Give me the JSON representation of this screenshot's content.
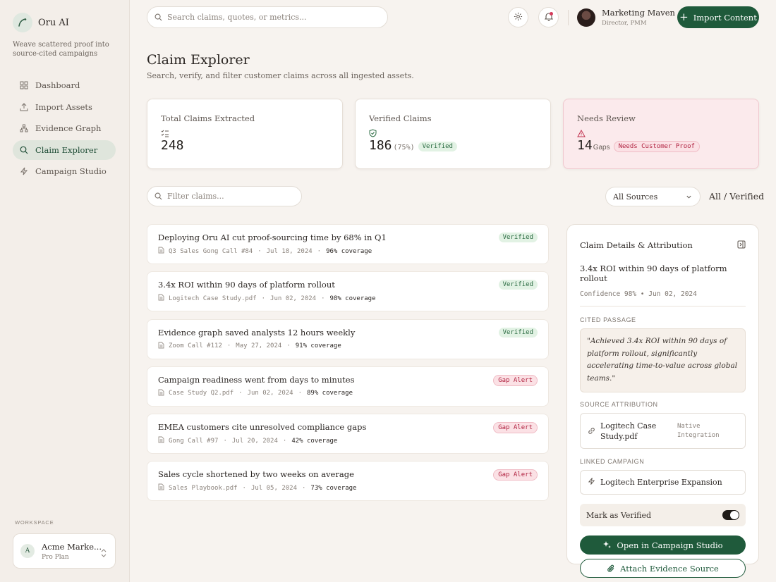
{
  "app": {
    "name": "Oru AI",
    "tagline": "Weave scattered proof into source-cited campaigns"
  },
  "sidebar": {
    "items": [
      {
        "label": "Dashboard",
        "icon": "grid-icon",
        "active": false
      },
      {
        "label": "Import Assets",
        "icon": "upload-icon",
        "active": false
      },
      {
        "label": "Evidence Graph",
        "icon": "graph-icon",
        "active": false
      },
      {
        "label": "Claim Explorer",
        "icon": "search-icon",
        "active": true
      },
      {
        "label": "Campaign Studio",
        "icon": "lightning-icon",
        "active": false
      }
    ],
    "workspace_label": "WORKSPACE",
    "workspace": {
      "initial": "A",
      "name": "Acme Marke...",
      "plan": "Pro Plan"
    }
  },
  "topbar": {
    "search_placeholder": "Search claims, quotes, or metrics...",
    "user_name": "Marketing Maven",
    "user_role": "Director, PMM",
    "import_label": "Import Content"
  },
  "page": {
    "title": "Claim Explorer",
    "subtitle": "Search, verify, and filter customer claims across all ingested assets."
  },
  "stats": [
    {
      "label": "Total Claims Extracted",
      "value": "248"
    },
    {
      "label": "Verified Claims",
      "value": "186",
      "sub": "(75%)",
      "badge": "Verified"
    },
    {
      "label": "Needs Review",
      "value": "14",
      "sub": "Gaps",
      "badge": "Needs Customer Proof"
    }
  ],
  "filters": {
    "filter_placeholder": "Filter claims...",
    "source_selected": "All Sources",
    "view_label": "All / Verified"
  },
  "claims": [
    {
      "title": "Deploying Oru AI cut proof-sourcing time by 68% in Q1",
      "source": "Q3 Sales Gong Call #84",
      "date": "Jul 18, 2024",
      "coverage": "96% coverage",
      "status": "Verified",
      "kind": "verified"
    },
    {
      "title": "3.4x ROI within 90 days of platform rollout",
      "source": "Logitech Case Study.pdf",
      "date": "Jun 02, 2024",
      "coverage": "98% coverage",
      "status": "Verified",
      "kind": "verified"
    },
    {
      "title": "Evidence graph saved analysts 12 hours weekly",
      "source": "Zoom Call #112",
      "date": "May 27, 2024",
      "coverage": "91% coverage",
      "status": "Verified",
      "kind": "verified"
    },
    {
      "title": "Campaign readiness went from days to minutes",
      "source": "Case Study Q2.pdf",
      "date": "Jun 02, 2024",
      "coverage": "89% coverage",
      "status": "Gap Alert",
      "kind": "gap"
    },
    {
      "title": "EMEA customers cite unresolved compliance gaps",
      "source": "Gong Call #97",
      "date": "Jul 20, 2024",
      "coverage": "42% coverage",
      "status": "Gap Alert",
      "kind": "gap"
    },
    {
      "title": "Sales cycle shortened by two weeks on average",
      "source": "Sales Playbook.pdf",
      "date": "Jul 05, 2024",
      "coverage": "73% coverage",
      "status": "Gap Alert",
      "kind": "gap"
    }
  ],
  "detail": {
    "title": "Claim Details & Attribution",
    "claim": "3.4x ROI within 90 days of platform rollout",
    "confidence": "Confidence 98% • Jun 02, 2024",
    "cited_label": "CITED PASSAGE",
    "passage": "\"Achieved 3.4x ROI within 90 days of platform rollout, significantly accelerating time-to-value across global teams.\"",
    "source_label": "SOURCE ATTRIBUTION",
    "source_name": "Logitech Case Study.pdf",
    "source_tag": "Native Integration",
    "campaign_label": "LINKED CAMPAIGN",
    "campaign_name": "Logitech Enterprise Expansion",
    "toggle_label": "Mark as Verified",
    "toggle_on": true,
    "open_label": "Open in Campaign Studio",
    "attach_label": "Attach Evidence Source"
  },
  "colors": {
    "accent": "#1f5a3b",
    "verified_bg": "#e2f2e4",
    "alert_bg": "#fbe1e5",
    "alert_text": "#b0213f"
  }
}
